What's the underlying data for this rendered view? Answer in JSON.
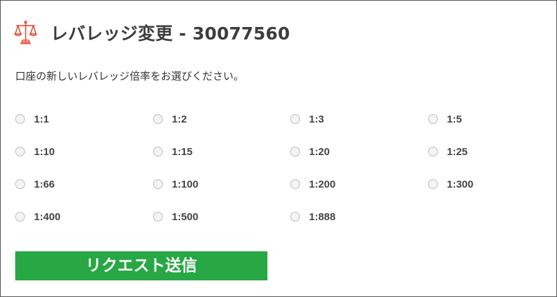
{
  "header": {
    "icon": "scale-icon",
    "title": "レバレッジ変更 - 30077560",
    "icon_color": "#e0402a"
  },
  "description": "口座の新しいレバレッジ倍率をお選びください。",
  "leverage_options": [
    [
      "1:1",
      "1:2",
      "1:3",
      "1:5"
    ],
    [
      "1:10",
      "1:15",
      "1:20",
      "1:25"
    ],
    [
      "1:66",
      "1:100",
      "1:200",
      "1:300"
    ],
    [
      "1:400",
      "1:500",
      "1:888"
    ]
  ],
  "submit": {
    "label": "リクエスト送信",
    "color": "#28a745"
  }
}
